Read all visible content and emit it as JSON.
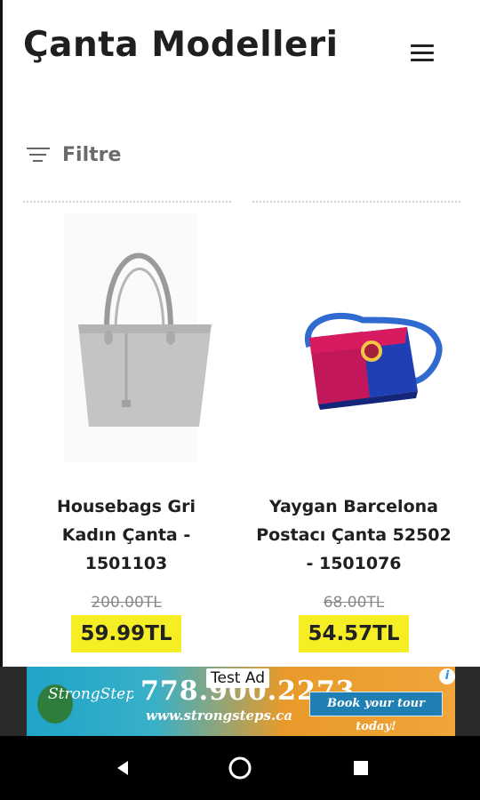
{
  "header": {
    "title": "Çanta Modelleri",
    "menu_icon": "hamburger-icon"
  },
  "filter": {
    "label": "Filtre",
    "icon": "filter-icon"
  },
  "products": [
    {
      "name": "Housebags Gri Kadın Çanta - 1501103",
      "old_price": "200.00TL",
      "price": "59.99TL",
      "image": "gray-tote-bag-image"
    },
    {
      "name": "Yaygan Barcelona Postacı Çanta 52502 - 1501076",
      "old_price": "68.00TL",
      "price": "54.57TL",
      "image": "barcelona-messenger-bag-image"
    }
  ],
  "ad": {
    "label": "Test Ad",
    "brand": "StrongSteps",
    "phone": "778.900.2273",
    "url": "www.strongsteps.ca",
    "cta": "Book your tour today!"
  },
  "colors": {
    "price_highlight": "#f6ee24",
    "title": "#1f1f1f",
    "navbar": "#000000"
  },
  "navbar": {
    "back_icon": "back-icon",
    "home_icon": "home-icon",
    "recents_icon": "recents-icon"
  }
}
